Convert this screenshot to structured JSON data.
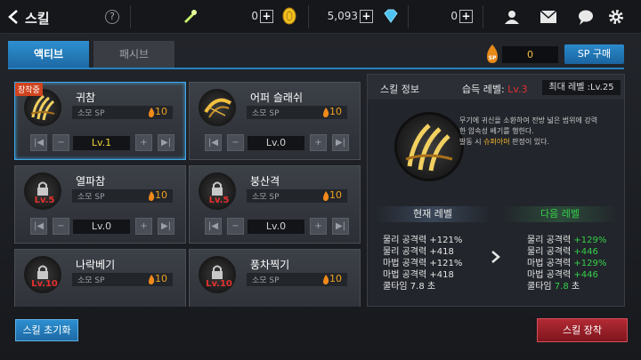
{
  "header": {
    "title": "스킬",
    "help": "?",
    "currency1": "0",
    "currency2": "0",
    "gold": "5,093",
    "gems": "0",
    "plus": "+"
  },
  "tabs": {
    "active": "액티브",
    "passive": "패시브"
  },
  "sp": {
    "value": "0",
    "buy_label": "SP 구매",
    "coin_label": "SP"
  },
  "skills": [
    {
      "name": "귀참",
      "cost_label": "소모 SP",
      "cost": "10",
      "level": "Lv.1",
      "level_color": "#f2d23a",
      "badge": "장착중",
      "lv_req": ""
    },
    {
      "name": "어퍼 슬래쉬",
      "cost_label": "소모 SP",
      "cost": "10",
      "level": "Lv.0",
      "level_color": "#d0d0d0",
      "badge": "",
      "lv_req": ""
    },
    {
      "name": "열파참",
      "cost_label": "소모 SP",
      "cost": "10",
      "level": "Lv.0",
      "level_color": "#d0d0d0",
      "badge": "",
      "lv_req": "Lv.5"
    },
    {
      "name": "붕산격",
      "cost_label": "소모 SP",
      "cost": "10",
      "level": "Lv.0",
      "level_color": "#d0d0d0",
      "badge": "",
      "lv_req": "Lv.5"
    },
    {
      "name": "나락베기",
      "cost_label": "소모 SP",
      "cost": "10",
      "level": "",
      "level_color": "#d0d0d0",
      "badge": "",
      "lv_req": "Lv.10"
    },
    {
      "name": "풍차찍기",
      "cost_label": "소모 SP",
      "cost": "10",
      "level": "",
      "level_color": "#d0d0d0",
      "badge": "",
      "lv_req": "Lv.10"
    }
  ],
  "controls": {
    "first": "|◀",
    "minus": "−",
    "plus": "+",
    "last": "▶|"
  },
  "detail": {
    "title": "스킬 정보",
    "acquire_label": "습득 레벨:",
    "acquire_value": "Lv.3",
    "max_level": "최대 레벨 :Lv.25",
    "desc_line1": "무기에 귀신을 소환하여 전방 넓은 범위에 강력",
    "desc_line2": "한 암속성 베기를 행한다.",
    "desc_line3_pre": "발동 시 ",
    "desc_line3_hl": "슈퍼아머",
    "desc_line3_post": " 판정이 있다.",
    "current_label": "현재 레벨",
    "next_label": "다음 레벨",
    "current_stats": [
      "물리 공격력 +121%",
      "물리 공격력 +418",
      "마법 공격력 +121%",
      "마법 공격력 +418"
    ],
    "current_cooldown": "쿨타임 7.8 초",
    "next_stats": [
      {
        "label": "물리 공격력",
        "value": "+129%"
      },
      {
        "label": "물리 공격력",
        "value": "+446"
      },
      {
        "label": "마법 공격력",
        "value": "+129%"
      },
      {
        "label": "마법 공격력",
        "value": "+446"
      }
    ],
    "next_cooldown_label": "쿨타임",
    "next_cooldown_value": "7.8",
    "next_cooldown_unit": "초"
  },
  "buttons": {
    "reset": "스킬 초기화",
    "equip": "스킬 장착"
  }
}
